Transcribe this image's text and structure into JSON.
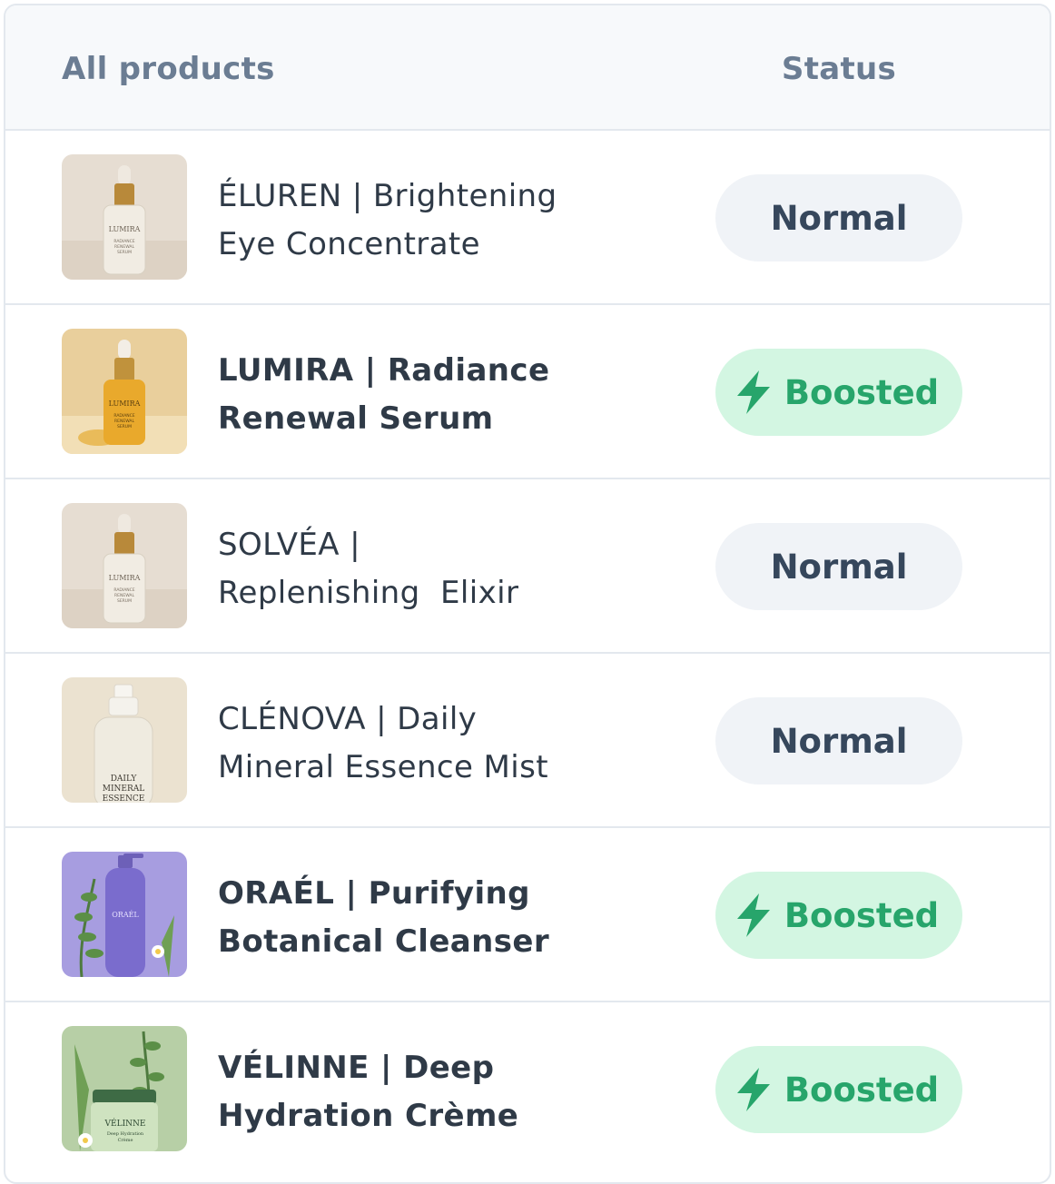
{
  "header": {
    "product_col": "All products",
    "status_col": "Status"
  },
  "colors": {
    "boosted_bg": "#d3f6e2",
    "boosted_text": "#27a56b",
    "normal_bg": "#f0f3f7",
    "normal_text": "#36475c",
    "header_text": "#6b7d93"
  },
  "products": [
    {
      "name_line1": "ÉLUREN | Brightening",
      "name_line2": "Eye Concentrate",
      "status": "Normal",
      "thumbnail_label": "LUMIRA"
    },
    {
      "name_line1": "LUMIRA | Radiance",
      "name_line2": "Renewal Serum",
      "status": "Boosted",
      "status_icon": "lightning-bolt-icon",
      "thumbnail_label": "LUMIRA"
    },
    {
      "name_line1": "SOLVÉA |",
      "name_line2": "Replenishing  Elixir",
      "status": "Normal",
      "thumbnail_label": "LUMIRA"
    },
    {
      "name_line1": "CLÉNOVA | Daily",
      "name_line2": "Mineral Essence Mist",
      "status": "Normal",
      "thumbnail_label": "DAILY MINERAL ESSENCE"
    },
    {
      "name_line1": "ORAÉL | Purifying",
      "name_line2": "Botanical Cleanser",
      "status": "Boosted",
      "status_icon": "lightning-bolt-icon",
      "thumbnail_label": "ORAÉL"
    },
    {
      "name_line1": "VÉLINNE | Deep",
      "name_line2": "Hydration Crème",
      "status": "Boosted",
      "status_icon": "lightning-bolt-icon",
      "thumbnail_label": "VÉLINNE"
    }
  ]
}
